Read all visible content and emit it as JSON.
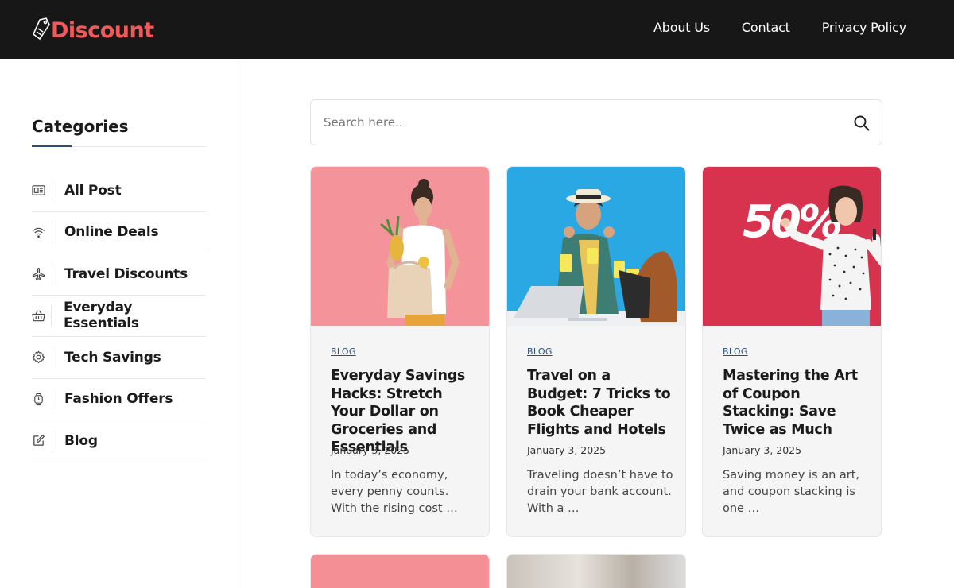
{
  "header": {
    "logo_text": "Discount",
    "nav": [
      "About Us",
      "Contact",
      "Privacy Policy"
    ]
  },
  "sidebar": {
    "title": "Categories",
    "items": [
      {
        "label": "All Post",
        "icon": "news-icon"
      },
      {
        "label": "Online Deals",
        "icon": "wifi-icon"
      },
      {
        "label": "Travel Discounts",
        "icon": "airplane-icon"
      },
      {
        "label": "Everyday Essentials",
        "icon": "basket-icon"
      },
      {
        "label": "Tech Savings",
        "icon": "gear-icon"
      },
      {
        "label": "Fashion Offers",
        "icon": "watch-icon"
      },
      {
        "label": "Blog",
        "icon": "edit-icon"
      }
    ]
  },
  "search": {
    "placeholder": "Search here.."
  },
  "posts": [
    {
      "tag": "BLOG",
      "title": "Everyday Savings Hacks: Stretch Your Dollar on Groceries and Essentials",
      "date": "January 3, 2025",
      "excerpt": "In today’s economy, every penny counts. With the rising cost …",
      "image_bg": "#f58f96"
    },
    {
      "tag": "BLOG",
      "title": "Travel on a Budget: 7 Tricks to Book Cheaper Flights and Hotels",
      "date": "January 3, 2025",
      "excerpt": "Traveling doesn’t have to drain your bank account. With a …",
      "image_bg": "#2aa8e4"
    },
    {
      "tag": "BLOG",
      "title": "Mastering the Art of Coupon Stacking: Save Twice as Much",
      "date": "January 3, 2025",
      "excerpt": "Saving money is an art, and coupon stacking is one …",
      "image_bg": "#d8334e",
      "image_text": "50%"
    }
  ],
  "colors": {
    "header_bg": "#171717",
    "brand": "#f05a5a",
    "accent": "#2d4e7a"
  }
}
